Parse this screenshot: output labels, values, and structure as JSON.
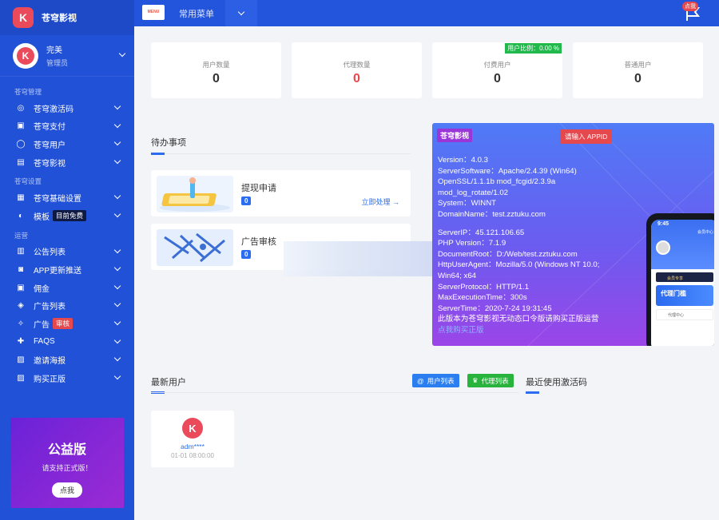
{
  "brand": {
    "name": "苍穹影视",
    "logo_letter": "K"
  },
  "user": {
    "name": "完美",
    "role": "管理员"
  },
  "sidebar": {
    "sections": [
      {
        "title": "苍穹管理",
        "items": [
          {
            "label": "苍穹激活码",
            "icon": "fingerprint-icon"
          },
          {
            "label": "苍穹支付",
            "icon": "wallet-icon"
          },
          {
            "label": "苍穹用户",
            "icon": "users-icon"
          },
          {
            "label": "苍穹影视",
            "icon": "film-icon"
          }
        ]
      },
      {
        "title": "苍穹设置",
        "items": [
          {
            "label": "苍穹基础设置",
            "icon": "settings-icon"
          },
          {
            "label": "模板",
            "icon": "palette-icon",
            "tag": "目前免费"
          }
        ]
      },
      {
        "title": "运营",
        "items": [
          {
            "label": "公告列表",
            "icon": "list-icon"
          },
          {
            "label": "APP更新推送",
            "icon": "robot-icon"
          },
          {
            "label": "佣金",
            "icon": "wallet-icon"
          },
          {
            "label": "广告列表",
            "icon": "tag-icon"
          },
          {
            "label": "广告",
            "icon": "lightbulb-icon",
            "tag": "审核"
          },
          {
            "label": "FAQS",
            "icon": "help-icon"
          },
          {
            "label": "邀请海报",
            "icon": "image-icon"
          },
          {
            "label": "购买正版",
            "icon": "image-icon"
          }
        ]
      }
    ]
  },
  "promo": {
    "title": "公益版",
    "subtitle": "请支持正式版！",
    "button": "点我"
  },
  "topbar": {
    "menu_icon_text": "MENU",
    "title": "常用菜单",
    "notify_badge": "点我"
  },
  "stats": [
    {
      "label": "用户数量",
      "value": "0",
      "color": "#333333"
    },
    {
      "label": "代理数量",
      "value": "0",
      "color": "#e5484d"
    },
    {
      "label": "付费用户",
      "value": "0",
      "color": "#333333",
      "badge": "用户比例：0.00 %"
    },
    {
      "label": "普通用户",
      "value": "0",
      "color": "#333333"
    }
  ],
  "todo": {
    "heading": "待办事项",
    "items": [
      {
        "title": "提现申请",
        "count": "0",
        "link": "立即处理"
      },
      {
        "title": "广告审核",
        "count": "0"
      }
    ]
  },
  "server": {
    "tag": "苍穹影视",
    "appid_button": "请输入 APPID",
    "lines_a": [
      "Version：4.0.3",
      "ServerSoftware：Apache/2.4.39 (Win64)",
      "OpenSSL/1.1.1b mod_fcgid/2.3.9a",
      "mod_log_rotate/1.02",
      "System：WINNT",
      "DomainName：test.zztuku.com"
    ],
    "lines_b": [
      "ServerIP：45.121.106.65",
      "PHP Version：7.1.9",
      "DocumentRoot：D:/Web/test.zztuku.com",
      "HttpUserAgent：Mozilla/5.0 (Windows NT 10.0;",
      "Win64; x64",
      "ServerProtocol：HTTP/1.1",
      "MaxExecutionTime：300s",
      "ServerTime：2020-7-24 19:31:45"
    ],
    "notice": "此版本为苍穹影视无动态口令版请购买正版运营",
    "notice_link": "点我购买正版",
    "phone": {
      "time": "9:45",
      "header": "会员中心",
      "vip": "会员专享",
      "card_title": "代理门槛",
      "row": "代理中心"
    }
  },
  "latest_users": {
    "heading": "最新用户",
    "btn_user_list": "用户列表",
    "btn_agent_list": "代理列表",
    "users": [
      {
        "name": "adm****",
        "date": "01-01 08:00:00"
      }
    ]
  },
  "recent_codes": {
    "heading": "最近使用激活码"
  }
}
